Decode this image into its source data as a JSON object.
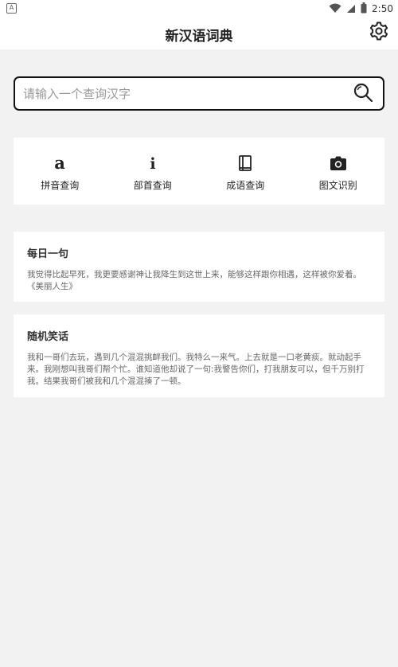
{
  "statusbar": {
    "time": "2:50",
    "notification_glyph": "A"
  },
  "app": {
    "title": "新汉语词典"
  },
  "search": {
    "placeholder": "请输入一个查询汉字",
    "value": ""
  },
  "query_options": [
    {
      "label": "拼音查询",
      "icon": "pinyin-a-icon"
    },
    {
      "label": "部首查询",
      "icon": "radical-i-icon"
    },
    {
      "label": "成语查询",
      "icon": "book-icon"
    },
    {
      "label": "图文识别",
      "icon": "camera-icon"
    }
  ],
  "daily_sentence": {
    "title": "每日一句",
    "text": "我觉得比起早死，我更要感谢神让我降生到这世上来，能够这样跟你相遇，这样被你爱着。《美丽人生》"
  },
  "random_joke": {
    "title": "随机笑话",
    "text": "我和一哥们去玩，遇到几个混混挑衅我们。我特么一来气。上去就是一口老黄痰。就动起手来。我刚想叫我哥们帮个忙。谁知道他却说了一句:我警告你们，打我朋友可以，但千万别打我。结果我哥们被我和几个混混揍了一顿。"
  },
  "colors": {
    "background": "#f2f2f2",
    "card": "#ffffff",
    "text": "#222222",
    "muted": "#666666"
  }
}
